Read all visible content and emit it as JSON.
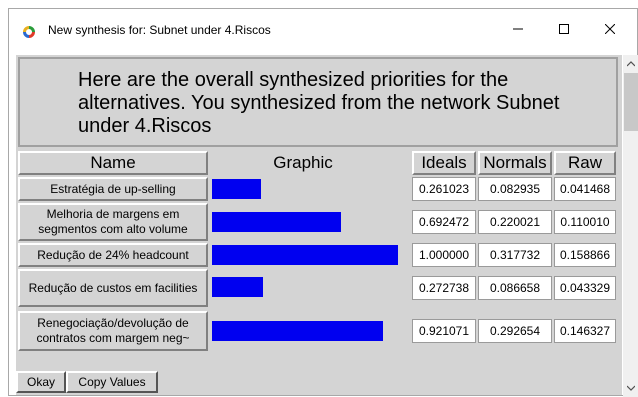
{
  "window": {
    "title": "New synthesis for: Subnet under 4.Riscos",
    "minimize_glyph": "—",
    "maximize_glyph": "☐",
    "close_glyph": "✕"
  },
  "header": {
    "text": "Here are the overall synthesized priorities for the alternatives.  You synthesized from the network Subnet under 4.Riscos"
  },
  "table": {
    "columns": [
      "Name",
      "Graphic",
      "Ideals",
      "Normals",
      "Raw"
    ],
    "rows": [
      {
        "name": "Estratégia de up-selling",
        "ideal": "0.261023",
        "normal": "0.082935",
        "raw": "0.041468",
        "bar_fraction": 0.261023
      },
      {
        "name": "Melhoria de margens em segmentos com alto volume",
        "ideal": "0.692472",
        "normal": "0.220021",
        "raw": "0.110010",
        "bar_fraction": 0.692472
      },
      {
        "name": "Redução de 24% headcount",
        "ideal": "1.000000",
        "normal": "0.317732",
        "raw": "0.158866",
        "bar_fraction": 1.0
      },
      {
        "name": "Redução de custos em facilities",
        "ideal": "0.272738",
        "normal": "0.086658",
        "raw": "0.043329",
        "bar_fraction": 0.272738
      },
      {
        "name": "Renegociação/devolução de contratos com margem neg~",
        "ideal": "0.921071",
        "normal": "0.292654",
        "raw": "0.146327",
        "bar_fraction": 0.921071
      }
    ]
  },
  "buttons": {
    "okay": "Okay",
    "copy_values": "Copy Values"
  },
  "colors": {
    "bar": "#0000f0",
    "panel": "#d4d4d4"
  }
}
